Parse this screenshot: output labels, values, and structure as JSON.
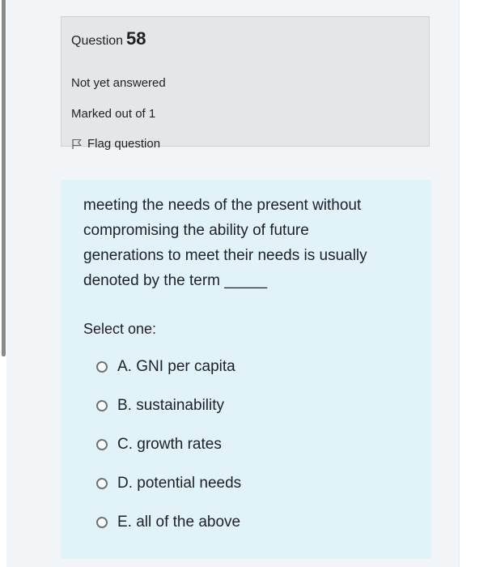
{
  "info": {
    "question_label": "Question",
    "question_number": "58",
    "state": "Not yet answered",
    "grade": "Marked out of 1",
    "flag_label": "Flag question"
  },
  "question": {
    "text_lines": [
      "meeting the needs of the present without",
      "compromising the ability of future",
      "generations to meet their needs is usually",
      "denoted by the term _____"
    ],
    "prompt": "Select one:",
    "options": [
      {
        "letter": "A.",
        "label": "GNI per capita"
      },
      {
        "letter": "B.",
        "label": "sustainability"
      },
      {
        "letter": "C.",
        "label": "growth rates"
      },
      {
        "letter": "D.",
        "label": "potential needs"
      },
      {
        "letter": "E.",
        "label": "all of the above"
      }
    ]
  },
  "colors": {
    "info_bg": "#e4e6e8",
    "formulation_bg": "#e1f3f8",
    "page_bg": "#f2f5f7"
  },
  "icons": {
    "flag": "flag-outline-icon",
    "radio": "radio-empty-icon"
  }
}
